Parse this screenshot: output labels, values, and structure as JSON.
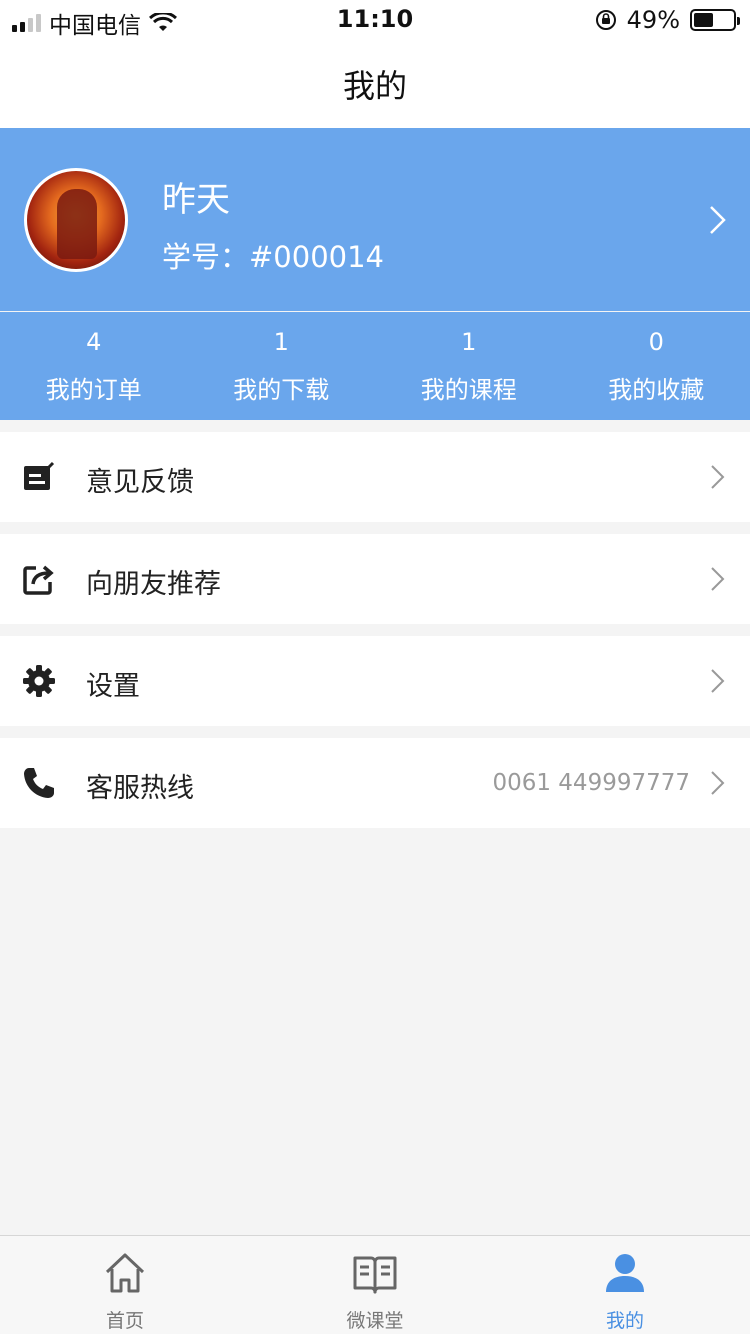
{
  "status_bar": {
    "carrier": "中国电信",
    "time": "11:10",
    "battery_text": "49%",
    "battery_level": 0.49,
    "icons": [
      "signal-icon",
      "wifi-icon",
      "rotation-lock-icon",
      "battery-icon"
    ]
  },
  "nav": {
    "title": "我的"
  },
  "profile": {
    "name": "昨天",
    "student_no": "学号：#000014",
    "avatar_icon": "avatar"
  },
  "stats": [
    {
      "count": "4",
      "label": "我的订单"
    },
    {
      "count": "1",
      "label": "我的下载"
    },
    {
      "count": "1",
      "label": "我的课程"
    },
    {
      "count": "0",
      "label": "我的收藏"
    }
  ],
  "menu": [
    {
      "label": "意见反馈",
      "icon": "feedback-icon"
    },
    {
      "label": "向朋友推荐",
      "icon": "share-icon"
    },
    {
      "label": "设置",
      "icon": "gear-icon"
    },
    {
      "label": "客服热线",
      "icon": "phone-icon",
      "value": "0061 449997777"
    }
  ],
  "tabs": [
    {
      "label": "首页",
      "icon": "home-icon"
    },
    {
      "label": "微课堂",
      "icon": "book-icon"
    },
    {
      "label": "我的",
      "icon": "user-icon",
      "active": true
    }
  ],
  "colors": {
    "accent": "#6aa6ec",
    "tab_active": "#4a90e2",
    "background": "#f4f4f4"
  }
}
